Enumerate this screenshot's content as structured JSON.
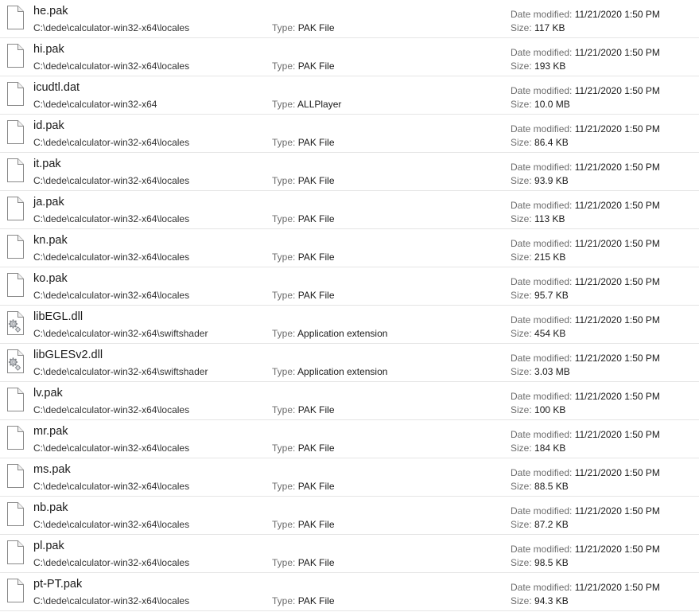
{
  "labels": {
    "type": "Type:",
    "date_modified": "Date modified:",
    "size": "Size:"
  },
  "files": [
    {
      "name": "he.pak",
      "path": "C:\\dede\\calculator-win32-x64\\locales",
      "type": "PAK File",
      "date": "11/21/2020 1:50 PM",
      "size": "117 KB",
      "icon": "document-icon"
    },
    {
      "name": "hi.pak",
      "path": "C:\\dede\\calculator-win32-x64\\locales",
      "type": "PAK File",
      "date": "11/21/2020 1:50 PM",
      "size": "193 KB",
      "icon": "document-icon"
    },
    {
      "name": "icudtl.dat",
      "path": "C:\\dede\\calculator-win32-x64",
      "type": "ALLPlayer",
      "date": "11/21/2020 1:50 PM",
      "size": "10.0 MB",
      "icon": "document-icon"
    },
    {
      "name": "id.pak",
      "path": "C:\\dede\\calculator-win32-x64\\locales",
      "type": "PAK File",
      "date": "11/21/2020 1:50 PM",
      "size": "86.4 KB",
      "icon": "document-icon"
    },
    {
      "name": "it.pak",
      "path": "C:\\dede\\calculator-win32-x64\\locales",
      "type": "PAK File",
      "date": "11/21/2020 1:50 PM",
      "size": "93.9 KB",
      "icon": "document-icon"
    },
    {
      "name": "ja.pak",
      "path": "C:\\dede\\calculator-win32-x64\\locales",
      "type": "PAK File",
      "date": "11/21/2020 1:50 PM",
      "size": "113 KB",
      "icon": "document-icon"
    },
    {
      "name": "kn.pak",
      "path": "C:\\dede\\calculator-win32-x64\\locales",
      "type": "PAK File",
      "date": "11/21/2020 1:50 PM",
      "size": "215 KB",
      "icon": "document-icon"
    },
    {
      "name": "ko.pak",
      "path": "C:\\dede\\calculator-win32-x64\\locales",
      "type": "PAK File",
      "date": "11/21/2020 1:50 PM",
      "size": "95.7 KB",
      "icon": "document-icon"
    },
    {
      "name": "libEGL.dll",
      "path": "C:\\dede\\calculator-win32-x64\\swiftshader",
      "type": "Application extension",
      "date": "11/21/2020 1:50 PM",
      "size": "454 KB",
      "icon": "dll-gear-icon"
    },
    {
      "name": "libGLESv2.dll",
      "path": "C:\\dede\\calculator-win32-x64\\swiftshader",
      "type": "Application extension",
      "date": "11/21/2020 1:50 PM",
      "size": "3.03 MB",
      "icon": "dll-gear-icon"
    },
    {
      "name": "lv.pak",
      "path": "C:\\dede\\calculator-win32-x64\\locales",
      "type": "PAK File",
      "date": "11/21/2020 1:50 PM",
      "size": "100 KB",
      "icon": "document-icon"
    },
    {
      "name": "mr.pak",
      "path": "C:\\dede\\calculator-win32-x64\\locales",
      "type": "PAK File",
      "date": "11/21/2020 1:50 PM",
      "size": "184 KB",
      "icon": "document-icon"
    },
    {
      "name": "ms.pak",
      "path": "C:\\dede\\calculator-win32-x64\\locales",
      "type": "PAK File",
      "date": "11/21/2020 1:50 PM",
      "size": "88.5 KB",
      "icon": "document-icon"
    },
    {
      "name": "nb.pak",
      "path": "C:\\dede\\calculator-win32-x64\\locales",
      "type": "PAK File",
      "date": "11/21/2020 1:50 PM",
      "size": "87.2 KB",
      "icon": "document-icon"
    },
    {
      "name": "pl.pak",
      "path": "C:\\dede\\calculator-win32-x64\\locales",
      "type": "PAK File",
      "date": "11/21/2020 1:50 PM",
      "size": "98.5 KB",
      "icon": "document-icon"
    },
    {
      "name": "pt-PT.pak",
      "path": "C:\\dede\\calculator-win32-x64\\locales",
      "type": "PAK File",
      "date": "11/21/2020 1:50 PM",
      "size": "94.3 KB",
      "icon": "document-icon"
    }
  ]
}
